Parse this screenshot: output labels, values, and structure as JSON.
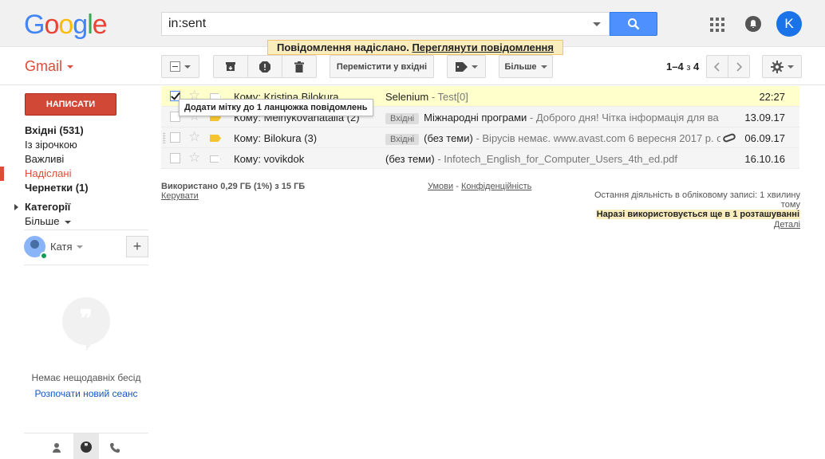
{
  "header": {
    "logo_letters": [
      {
        "ch": "G",
        "color": "#4285f4"
      },
      {
        "ch": "o",
        "color": "#ea4335"
      },
      {
        "ch": "o",
        "color": "#fbbc05"
      },
      {
        "ch": "g",
        "color": "#4285f4"
      },
      {
        "ch": "l",
        "color": "#34a853"
      },
      {
        "ch": "e",
        "color": "#ea4335"
      }
    ],
    "search_value": "in:sent",
    "avatar_letter": "K"
  },
  "notification": {
    "text": "Повідомлення надіслано.",
    "link": "Переглянути повідомлення"
  },
  "app": {
    "name": "Gmail",
    "accent": "#dd4b39"
  },
  "toolbar": {
    "move_inbox": "Перемістити у вхідні",
    "more": "Більше",
    "page_range": "1–4",
    "page_of": "з",
    "page_total": "4"
  },
  "sidebar": {
    "compose": "НАПИСАТИ",
    "items": [
      {
        "label": "Вхідні (531)",
        "bold": true,
        "active": false
      },
      {
        "label": "Із зірочкою",
        "bold": false,
        "active": false
      },
      {
        "label": "Важливі",
        "bold": false,
        "active": false
      },
      {
        "label": "Надіслані",
        "bold": false,
        "active": true
      },
      {
        "label": "Чернетки (1)",
        "bold": true,
        "active": false
      }
    ],
    "categories": "Категорії",
    "more": "Більше"
  },
  "hangouts": {
    "user_name": "Катя",
    "no_chats": "Немає нещодавніх бесід",
    "new_session": "Розпочати новий сеанс"
  },
  "emails": [
    {
      "sender": "Кому: Kristina Bilokura",
      "label": "",
      "subject": "Selenium",
      "snippet": " - Test[0]",
      "date": "22:27",
      "checked": true,
      "important": false,
      "attachment": false
    },
    {
      "sender": "Кому: Melnykovanatalia (2)",
      "label": "Вхідні",
      "subject": "Міжнародні програми",
      "snippet": " - Доброго дня! Чітка інформація для ва",
      "date": "13.09.17",
      "checked": false,
      "important": true,
      "attachment": false
    },
    {
      "sender": "Кому: Bilokura (3)",
      "label": "Вхідні",
      "subject": "(без теми)",
      "snippet": " - Вірусів немає. www.avast.com 6 вересня 2017 р. о",
      "date": "06.09.17",
      "checked": false,
      "important": true,
      "attachment": true
    },
    {
      "sender": "Кому: vovikdok",
      "label": "",
      "subject": "(без теми)",
      "snippet": " -  Infotech_English_for_Computer_Users_4th_ed.pdf",
      "date": "16.10.16",
      "checked": false,
      "important": false,
      "attachment": false
    }
  ],
  "tooltip": "Додати мітку до 1 ланцюжка повідомлень",
  "footer": {
    "usage": "Використано 0,29 ГБ (1%) з 15 ГБ",
    "manage": "Керувати",
    "terms": "Умови",
    "privacy": "Конфіденційність",
    "activity_line1": "Остання діяльність в обліковому записі: 1 хвилину",
    "activity_line2": "тому",
    "active_elsewhere": "Наразі використовується ще в 1 розташуванні",
    "details": "Деталі"
  }
}
